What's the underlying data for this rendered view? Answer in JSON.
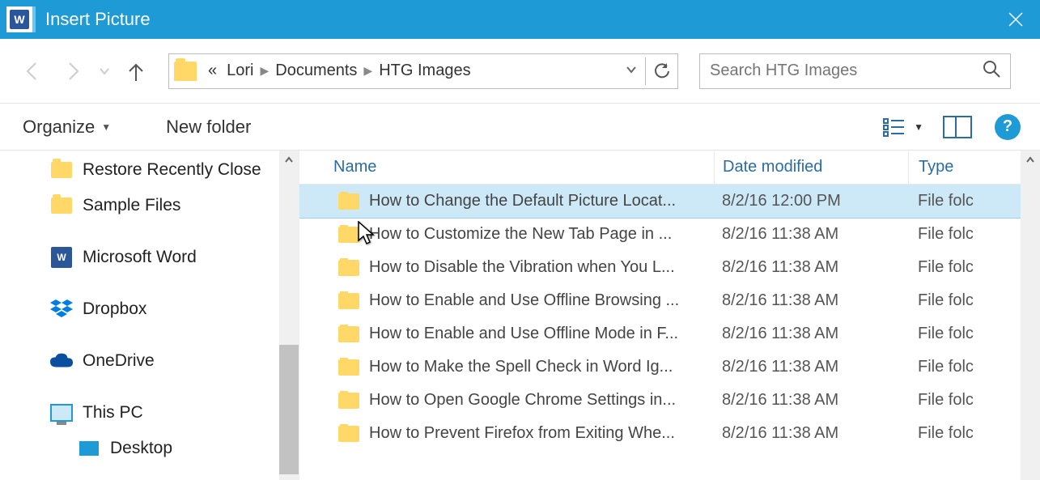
{
  "title": "Insert Picture",
  "breadcrumb": {
    "prefix": "«",
    "seg1": "Lori",
    "seg2": "Documents",
    "seg3": "HTG Images"
  },
  "search": {
    "placeholder": "Search HTG Images"
  },
  "toolbar": {
    "organize": "Organize",
    "newfolder": "New folder"
  },
  "sidebar": {
    "items": [
      {
        "label": "Restore Recently Close"
      },
      {
        "label": "Sample Files"
      },
      {
        "label": "Microsoft Word"
      },
      {
        "label": "Dropbox"
      },
      {
        "label": "OneDrive"
      },
      {
        "label": "This PC"
      },
      {
        "label": "Desktop"
      }
    ]
  },
  "columns": {
    "name": "Name",
    "date": "Date modified",
    "type": "Type"
  },
  "files": [
    {
      "name": "How to Change the Default Picture Locat...",
      "date": "8/2/16 12:00 PM",
      "type": "File folc",
      "selected": true
    },
    {
      "name": "How to Customize the New Tab Page in ...",
      "date": "8/2/16 11:38 AM",
      "type": "File folc"
    },
    {
      "name": "How to Disable the Vibration when You L...",
      "date": "8/2/16 11:38 AM",
      "type": "File folc"
    },
    {
      "name": "How to Enable and Use Offline Browsing ...",
      "date": "8/2/16 11:38 AM",
      "type": "File folc"
    },
    {
      "name": "How to Enable and Use Offline Mode in F...",
      "date": "8/2/16 11:38 AM",
      "type": "File folc"
    },
    {
      "name": "How to Make the Spell Check in Word Ig...",
      "date": "8/2/16 11:38 AM",
      "type": "File folc"
    },
    {
      "name": "How to Open Google Chrome Settings in...",
      "date": "8/2/16 11:38 AM",
      "type": "File folc"
    },
    {
      "name": "How to Prevent Firefox from Exiting Whe...",
      "date": "8/2/16 11:38 AM",
      "type": "File folc"
    }
  ]
}
